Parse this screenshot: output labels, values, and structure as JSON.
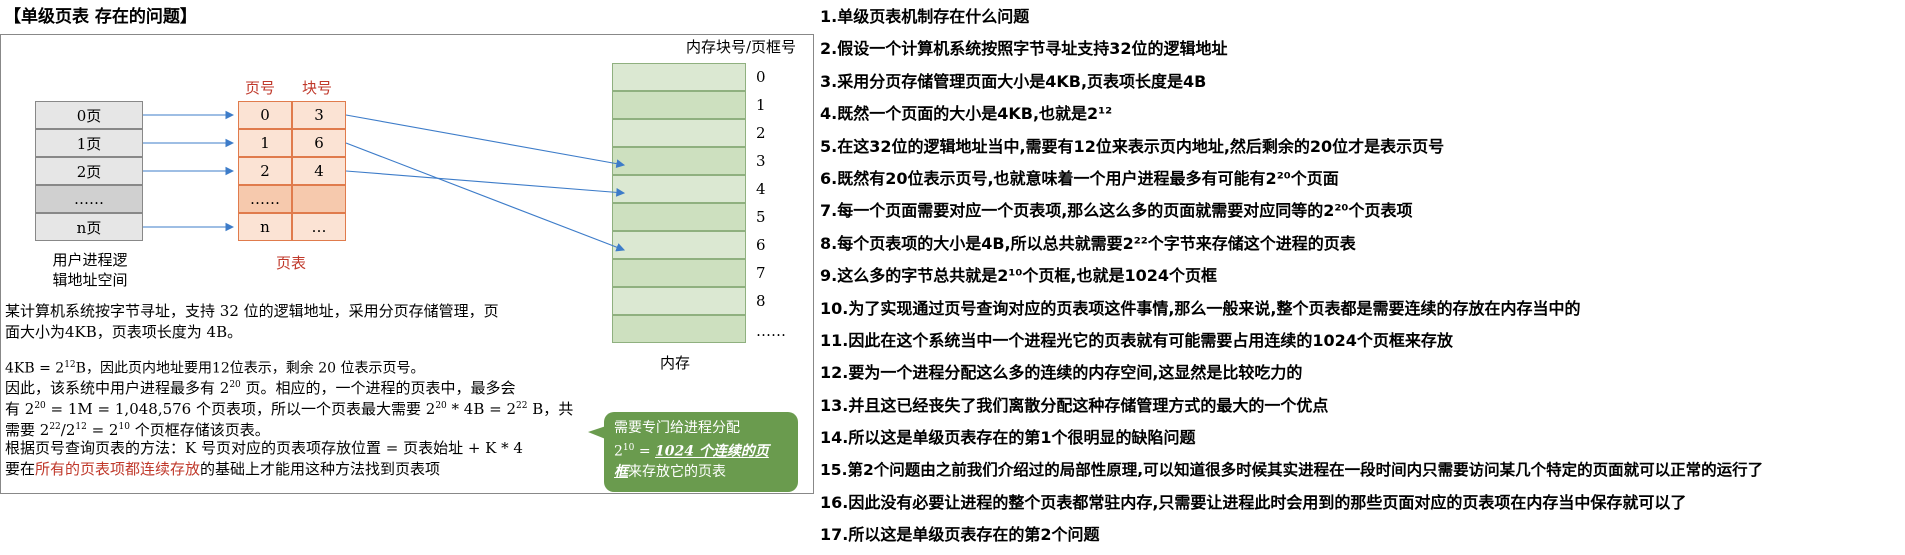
{
  "title": "【单级页表 存在的问题】",
  "diagram": {
    "memory_header": "内存块号/页框号",
    "page_no_header": "页号",
    "block_no_header": "块号",
    "pages": [
      "0页",
      "1页",
      "2页",
      "……",
      "n页"
    ],
    "page_table": [
      [
        "0",
        "3"
      ],
      [
        "1",
        "6"
      ],
      [
        "2",
        "4"
      ],
      [
        "……",
        ""
      ],
      [
        "n",
        "…"
      ]
    ],
    "user_space_label_1": "用户进程逻",
    "user_space_label_2": "辑地址空间",
    "page_table_label": "页表",
    "memory_indices": [
      "0",
      "1",
      "2",
      "3",
      "4",
      "5",
      "6",
      "7",
      "8",
      "……"
    ],
    "memory_label": "内存"
  },
  "paragraphs": {
    "p1_line1": "某计算机系统按字节寻址，支持 32 位的逻辑地址，采用分页存储管理，页",
    "p1_line2": "面大小为4KB，页表项长度为 4B。",
    "p2_a": "4KB = 2",
    "p2_a_sup": "12",
    "p2_a_rest": "B，因此页内地址要用12位表示，剩余 20 位表示页号。",
    "p3_a": "因此，该系统中用户进程最多有 2",
    "p3_a_sup": "20",
    "p3_a_rest": " 页。相应的，一个进程的页表中，最多会",
    "p4_a": "有 2",
    "p4_a_sup": "20",
    "p4_b": " = 1M = 1,048,576 个页表项，所以一个页表最大需要  2",
    "p4_b_sup": "20",
    "p4_c": " * 4B = 2",
    "p4_c_sup": "22",
    "p4_d": " B，共",
    "p5_a": "需要 2",
    "p5_a_sup": "22",
    "p5_b": "/2",
    "p5_b_sup": "12",
    "p5_c": " = 2",
    "p5_c_sup": "10",
    "p5_d": " 个页框存储该页表。",
    "p6": "根据页号查询页表的方法：K 号页对应的页表项存放位置 = 页表始址 + K * 4",
    "p7_a": "要在",
    "p7_red": "所有的页表项都连续存放",
    "p7_b": "的基础上才能用这种方法找到页表项"
  },
  "bubble": {
    "line1": "需要专门给进程分配",
    "l2_a": "2",
    "l2_sup": "10",
    "l2_b": " = ",
    "l2_em": "1024 个连续的页",
    "l3_em": "框",
    "l3_rest": "来存放它的页表"
  },
  "notes": [
    "1.单级页表机制存在什么问题",
    "2.假设一个计算机系统按照字节寻址支持32位的逻辑地址",
    "3.采用分页存储管理页面大小是4KB,页表项长度是4B",
    "4.既然一个页面的大小是4KB,也就是2¹²",
    "5.在这32位的逻辑地址当中,需要有12位来表示页内地址,然后剩余的20位才是表示页号",
    "6.既然有20位表示页号,也就意味着一个用户进程最多有可能有2²⁰个页面",
    "7.每一个页面需要对应一个页表项,那么这么多的页面就需要对应同等的2²⁰个页表项",
    "8.每个页表项的大小是4B,所以总共就需要2²²个字节来存储这个进程的页表",
    "9.这么多的字节总共就是2¹⁰个页框,也就是1024个页框",
    "10.为了实现通过页号查询对应的页表项这件事情,那么一般来说,整个页表都是需要连续的存放在内存当中的",
    "11.因此在这个系统当中一个进程光它的页表就有可能需要占用连续的1024个页框来存放",
    "12.要为一个进程分配这么多的连续的内存空间,这显然是比较吃力的",
    "13.并且这已经丧失了我们离散分配这种存储管理方式的最大的一个优点",
    "14.所以这是单级页表存在的第1个很明显的缺陷问题",
    "15.第2个问题由之前我们介绍过的局部性原理,可以知道很多时候其实进程在一段时间内只需要访问某几个特定的页面就可以正常的运行了",
    "16.因此没有必要让进程的整个页表都常驻内存,只需要让进程此时会用到的那些页面对应的页表项在内存当中保存就可以了",
    "17.所以这是单级页表存在的第2个问题"
  ]
}
